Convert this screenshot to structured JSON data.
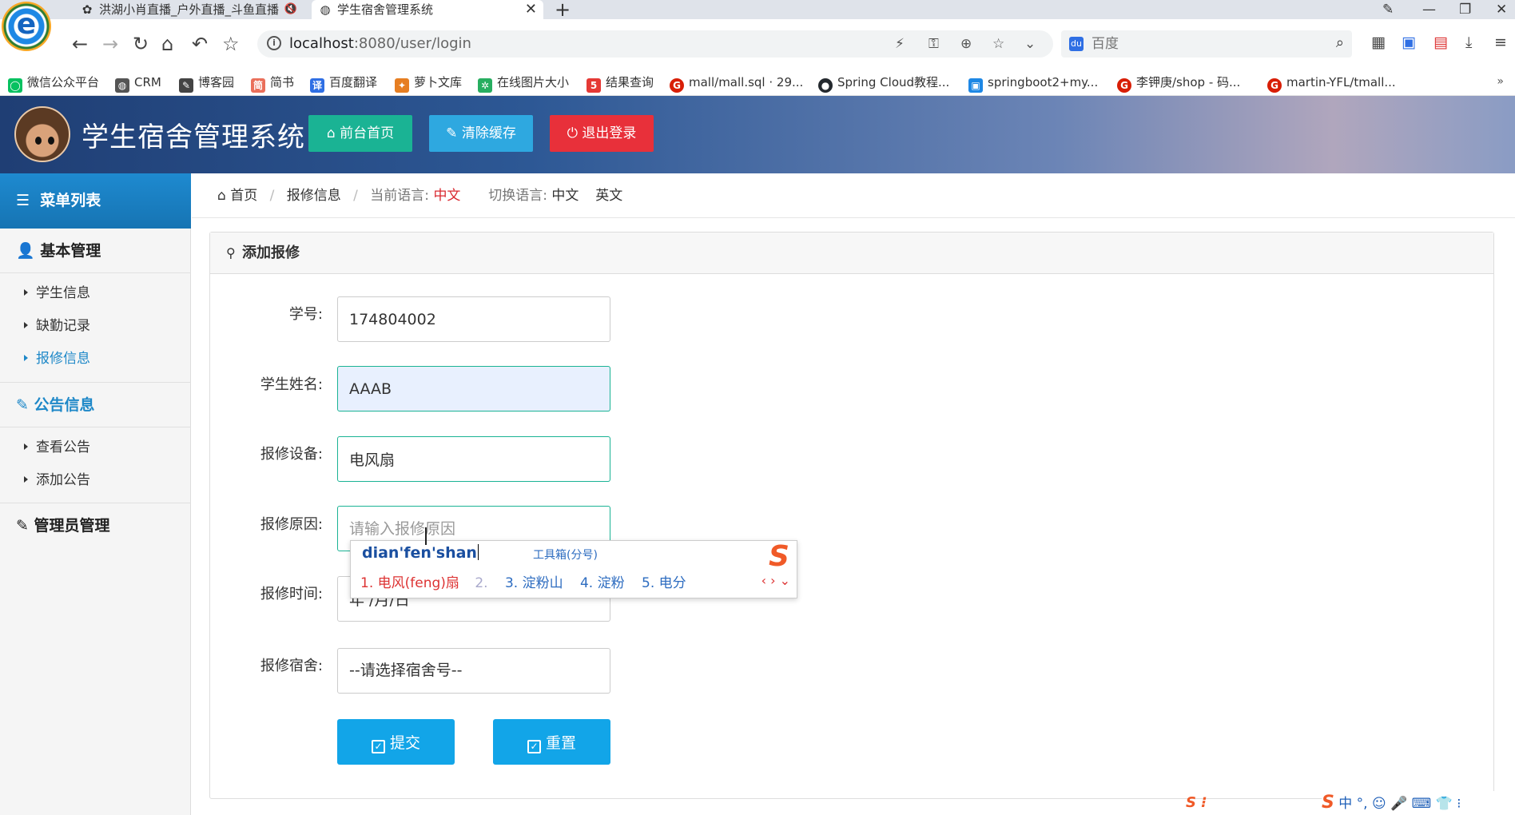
{
  "browser": {
    "tabs": [
      {
        "title": "洪湖小肖直播_户外直播_斗鱼直播",
        "active": false
      },
      {
        "title": "学生宿舍管理系统",
        "active": true
      }
    ],
    "url_host": "localhost",
    "url_path": ":8080/user/login",
    "search_placeholder": "百度",
    "search_logo": "du",
    "new_tab": "+",
    "bookmarks": [
      {
        "label": "微信公众平台",
        "color": "#07c160"
      },
      {
        "label": "CRM",
        "color": "#555555"
      },
      {
        "label": "博客园",
        "color": "#444444"
      },
      {
        "label": "简书",
        "color": "#ea6f5a"
      },
      {
        "label": "百度翻译",
        "color": "#2f6fe4"
      },
      {
        "label": "萝卜文库",
        "color": "#e67e22"
      },
      {
        "label": "在线图片大小",
        "color": "#27ae60"
      },
      {
        "label": "结果查询",
        "color": "#e53935"
      },
      {
        "label": "mall/mall.sql · 29...",
        "color": "#d81e06"
      },
      {
        "label": "Spring Cloud教程...",
        "color": "#24292e"
      },
      {
        "label": "springboot2+my...",
        "color": "#1e88e5"
      },
      {
        "label": "李钾庚/shop - 码...",
        "color": "#d81e06"
      },
      {
        "label": "martin-YFL/tmall...",
        "color": "#d81e06"
      }
    ],
    "bookmarks_more": "»"
  },
  "header": {
    "title": "学生宿舍管理系统",
    "buttons": {
      "home": "前台首页",
      "clear_cache": "清除缓存",
      "logout": "退出登录"
    },
    "colors": {
      "green": "#1ab394",
      "blue": "#2ea8e0",
      "red": "#e8303a"
    }
  },
  "sidebar": {
    "title": "菜单列表",
    "groups": [
      {
        "label": "基本管理",
        "items": [
          "学生信息",
          "缺勤记录",
          "报修信息"
        ]
      },
      {
        "label": "公告信息",
        "items": [
          "查看公告",
          "添加公告"
        ]
      },
      {
        "label": "管理员管理",
        "items": []
      }
    ],
    "active_item": "报修信息"
  },
  "breadcrumb": {
    "home": "首页",
    "current": "报修信息",
    "lang_label": "当前语言:",
    "lang_value": "中文",
    "switch_label": "切换语言:",
    "lang_zh": "中文",
    "lang_en": "英文"
  },
  "panel": {
    "title": "添加报修"
  },
  "form": {
    "student_id": {
      "label": "学号:",
      "value": "174804002"
    },
    "student_name": {
      "label": "学生姓名:",
      "value": "AAAB"
    },
    "equipment": {
      "label": "报修设备:",
      "value": "电风扇"
    },
    "reason": {
      "label": "报修原因:",
      "placeholder": "请输入报修原因"
    },
    "time": {
      "label": "报修时间:",
      "value": "年 /月/日"
    },
    "dorm": {
      "label": "报修宿舍:",
      "value": "--请选择宿舍号--"
    },
    "submit": "提交",
    "reset": "重置"
  },
  "ime": {
    "pinyin": "dian'fen'shan",
    "toolbox": "工具箱(分号)",
    "candidates": [
      "1. 电风(feng)扇",
      "2.",
      "3. 淀粉山",
      "4. 淀粉",
      "5. 电分"
    ],
    "nav": "‹ › ⌄"
  },
  "tray": {
    "items": "中 °, ☺ 🎤 ⌨ 👕 ⁝"
  }
}
